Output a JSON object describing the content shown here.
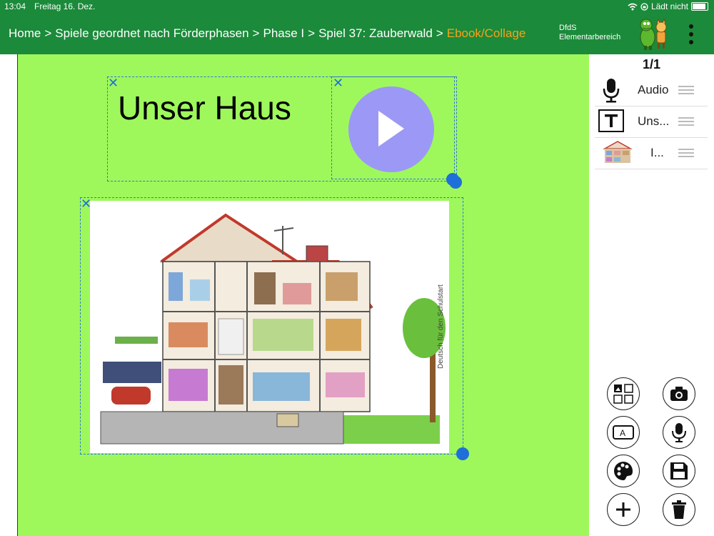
{
  "status": {
    "time": "13:04",
    "date": "Freitag 16. Dez.",
    "charge": "Lädt nicht"
  },
  "breadcrumb": {
    "sep": ">",
    "home": "Home",
    "games": "Spiele geordnet nach Förderphasen",
    "phase": "Phase I",
    "game": "Spiel 37: Zauberwald",
    "current": "Ebook/Collage"
  },
  "brand": {
    "line1": "DfdS",
    "line2": "Elementarbereich"
  },
  "canvas": {
    "title": "Unser Haus",
    "image_caption": "Deutsch für den Schulstart"
  },
  "sidebar": {
    "page_counter": "1/1",
    "layers": [
      {
        "label": "Audio",
        "icon": "microphone-icon"
      },
      {
        "label": "Uns...",
        "icon": "text-box-icon"
      },
      {
        "label": "I...",
        "icon": "house-thumbnail"
      }
    ]
  },
  "tools": [
    {
      "icon": "image-collage-icon"
    },
    {
      "icon": "camera-icon"
    },
    {
      "icon": "text-field-icon"
    },
    {
      "icon": "microphone-icon"
    },
    {
      "icon": "palette-icon"
    },
    {
      "icon": "save-icon"
    },
    {
      "icon": "plus-icon"
    },
    {
      "icon": "trash-icon"
    }
  ],
  "colors": {
    "header": "#1b8a3a",
    "canvas": "#9ef85c",
    "accent": "#f7a21b",
    "selection": "#1e6fd9",
    "play": "#9c98f5"
  }
}
